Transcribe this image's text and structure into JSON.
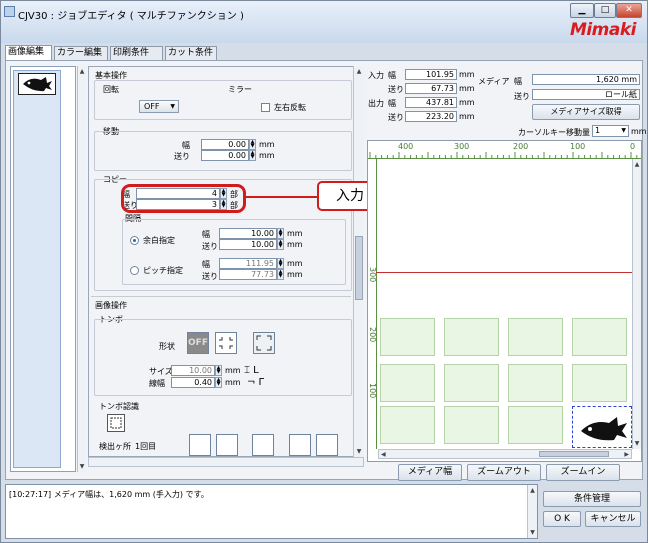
{
  "window": {
    "title": "CJV30 : ジョブエディタ ( マルチファンクション )",
    "brand": "Mimaki",
    "brand_color": "#d81c20",
    "caption_buttons": [
      "▁",
      "□",
      "✕"
    ]
  },
  "tabs": [
    "画像編集",
    "カラー編集",
    "印刷条件",
    "カット条件"
  ],
  "panel": {
    "basic_ops": {
      "title": "基本操作",
      "rotation": {
        "label": "回転",
        "value": "OFF"
      },
      "mirror": {
        "label": "ミラー",
        "checkbox_label": "左右反転"
      },
      "move": {
        "title": "移動",
        "width_label": "幅",
        "width_value": "0.00",
        "feed_label": "送り",
        "feed_value": "0.00",
        "unit": "mm"
      },
      "copy": {
        "title": "コピー",
        "width_label": "幅",
        "width_value": "4",
        "feed_label": "送り",
        "feed_value": "3",
        "unit": "部",
        "interval_title": "間隔",
        "margin_label": "余白指定",
        "margin_width_label": "幅",
        "margin_width": "10.00",
        "margin_feed_label": "送り",
        "margin_feed": "10.00",
        "pitch_label": "ピッチ指定",
        "pitch_width_label": "幅",
        "pitch_width": "111.95",
        "pitch_feed_label": "送り",
        "pitch_feed": "77.73",
        "mm": "mm"
      }
    },
    "image_ops": {
      "title": "画像操作",
      "tombo": {
        "title": "トンボ",
        "shape_label": "形状",
        "off_text": "OFF",
        "size_label": "サイズ",
        "size_value": "10.00",
        "line_label": "線幅",
        "line_value": "0.40",
        "unit": "mm"
      },
      "tombo_detect": {
        "title": "トンボ認識",
        "count_label": "検出ヶ所",
        "count_value": "1回目"
      }
    }
  },
  "info": {
    "input_label": "入力",
    "width_label": "幅",
    "feed_label": "送り",
    "output_label": "出力",
    "in_width": "101.95",
    "in_feed": "67.73",
    "out_width": "437.81",
    "out_feed": "223.20",
    "unit": "mm",
    "media_label": "メディア",
    "media_width_label": "幅",
    "media_width": "1,620 mm",
    "media_feed_label": "送り",
    "media_feed": "ロール紙",
    "get_media_size": "メディアサイズ取得",
    "cursor_move_label": "カーソルキー移動量",
    "cursor_move_value": "1",
    "cursor_move_unit": "mm"
  },
  "ruler": {
    "ticks": [
      "400",
      "300",
      "200",
      "100",
      "0"
    ],
    "vticks": [
      "300",
      "200",
      "100"
    ]
  },
  "bottom_buttons": [
    "メディア幅",
    "ズームアウト",
    "ズームイン"
  ],
  "log": {
    "text": "[10:27:17] メディア幅は、1,620 mm (手入力) です。"
  },
  "right_buttons": {
    "condition": "条件管理",
    "ok": "O K",
    "cancel": "キャンセル"
  },
  "callout": {
    "text": "入力"
  }
}
